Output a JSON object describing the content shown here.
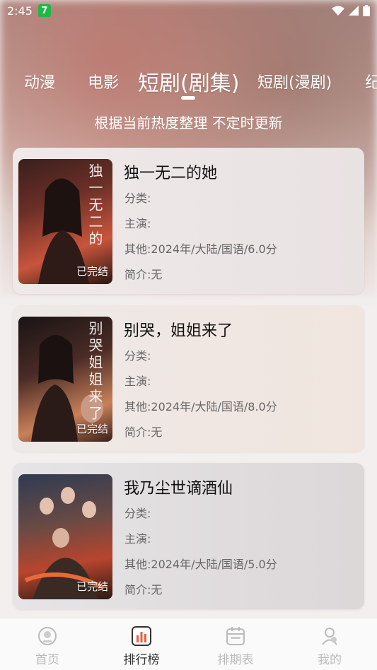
{
  "status_bar": {
    "time": "2:45",
    "notification_badge": "7"
  },
  "tabs": [
    {
      "label": "动漫",
      "active": false
    },
    {
      "label": "电影",
      "active": false
    },
    {
      "label": "短剧(剧集)",
      "active": true
    },
    {
      "label": "短剧(漫剧)",
      "active": false
    },
    {
      "label": "纪",
      "active": false
    }
  ],
  "subtitle": "根据当前热度整理 不定时更新",
  "cards": [
    {
      "title": "独一无二的她",
      "category": "分类:",
      "cast": "主演:",
      "other": "其他:2024年/大陆/国语/6.0分",
      "intro": "简介:无",
      "badge": "已完结",
      "cover_text": "独一无二的",
      "accent": "#8a3a2e"
    },
    {
      "title": "别哭，姐姐来了",
      "category": "分类:",
      "cast": "主演:",
      "other": "其他:2024年/大陆/国语/8.0分",
      "intro": "简介:无",
      "badge": "已完结",
      "cover_text": "别哭姐姐来了",
      "accent": "#7a2a25"
    },
    {
      "title": "我乃尘世谪酒仙",
      "category": "分类:",
      "cast": "主演:",
      "other": "其他:2024年/大陆/国语/5.0分",
      "intro": "简介:无",
      "badge": "已完结",
      "cover_text": "",
      "accent": "#3a3a5a"
    }
  ],
  "bottom_nav": [
    {
      "label": "首页",
      "icon": "home-icon",
      "active": false
    },
    {
      "label": "排行榜",
      "icon": "ranking-icon",
      "active": true
    },
    {
      "label": "排期表",
      "icon": "schedule-icon",
      "active": false
    },
    {
      "label": "我的",
      "icon": "profile-icon",
      "active": false
    }
  ],
  "colors": {
    "active_nav": "#333333",
    "inactive_nav": "#bbbbbb",
    "badge_green": "#1fb845"
  }
}
